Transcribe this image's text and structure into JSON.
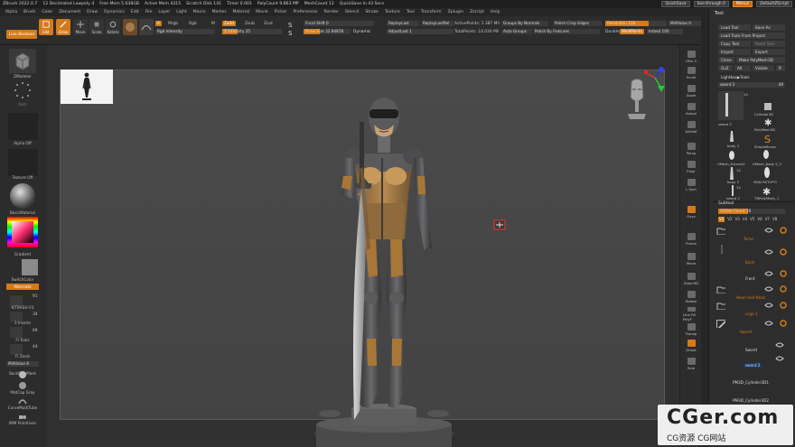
{
  "titlebar": {
    "app": "ZBrush 2022.0.7",
    "items": [
      "12 Decimated Lowpoly 4",
      "Free Mem 5.638GB",
      "Active Mem 4315",
      "Scratch Disk 141",
      "Timer 0.001",
      "PolyCount 9.863 MP",
      "MeshCount 12",
      "QuickSave In 43 Secs"
    ],
    "quicksave": "QuickSave",
    "see_through": "See-through  0",
    "menus": "Menus",
    "default_script": "DefaultZScript"
  },
  "menubar": [
    "Alpha",
    "Brush",
    "Color",
    "Document",
    "Draw",
    "Dynamics",
    "Edit",
    "File",
    "Layer",
    "Light",
    "Macro",
    "Marker",
    "Material",
    "Movie",
    "Picker",
    "Preferences",
    "Render",
    "Stencil",
    "Stroke",
    "Texture",
    "Tool",
    "Transform",
    "Zplugin",
    "Zscript",
    "Help"
  ],
  "topshelf": {
    "lightbox": "Live Boolean",
    "buttons": [
      "Edit",
      "Draw",
      "Move",
      "Scale",
      "Rotate"
    ],
    "a_btn": "A",
    "mrgb": "Mrgb",
    "rgb": "Rgb",
    "m": "M",
    "zadd": "Zadd",
    "zsub": "Zsub",
    "zcut": "Zcut",
    "rgb_intensity": "Rgb Intensity",
    "z_intensity": "Z Intensity 25",
    "focal_shift": "Focal Shift 0",
    "draw_size": "Draw Size 22.84878",
    "dynamic": "Dynamic",
    "replay_last": "ReplayLast",
    "replay_last_rel": "ReplayLastRel",
    "adjust_last": "AdjustLast 1",
    "active_points": "ActivePoints: 1.387 Mil",
    "total_points": "TotalPoints: 14.026 Mil",
    "groups_by_normals": "Groups By Normals",
    "auto_groups": "Auto Groups",
    "polish_crisp": "Polish Crisp Edges",
    "polish_features": "Polish By Features",
    "resolution": "Resolution 128",
    "double": "Double",
    "weld_points": "WeldPoints",
    "imbed": "Imbed 100",
    "mid_value": "MidValue 0"
  },
  "leftshelf": {
    "zmodeler": "ZModeler",
    "dots": "Dots",
    "alpha_off": "Alpha Off",
    "texture_off": "Texture Off",
    "basic_material": "BasicMaterial",
    "gradient": "Gradient",
    "switch_color": "SwitchColor",
    "alternate": "Alternate",
    "kitbash": "KITBASH V3",
    "kitbash_n": "91",
    "inserts": "3 Inserts",
    "inserts_n": "34",
    "fi_tools": "FI Tools",
    "fi_tools_n": "69",
    "fi_zools": "FI Zools",
    "fi_zools_n": "44",
    "mid_value": "MidValue 8",
    "backface_mask": "BackfaceMask",
    "matcap_gray": "MatCap Gray",
    "curve_multi": "CurveMultiTube",
    "imm_primitives": "IMM Primitives"
  },
  "rightshelf": [
    "SPix 3",
    "Scroll",
    "Zoom",
    "Actual",
    "AAHalf",
    "Persp",
    "Floor",
    "L.Sym",
    "Gxyz",
    "Frame",
    "Move",
    "Zoom3D",
    "Rotate",
    "Line Fill PolyF",
    "Transp",
    "Ghost",
    "Solo"
  ],
  "tool": {
    "title": "Tool",
    "buttons": [
      "Load Tool",
      "Save As",
      "Load Tools From Project",
      "Copy Tool",
      "Paste Tool",
      "Import",
      "Export",
      "Clone",
      "Make PolyMesh3D",
      "GoZ",
      "All",
      "Visible",
      "R"
    ],
    "lightbox_tools": "Lightbox▶Tools",
    "current_tool": "sword 2",
    "current_n": "49",
    "thumbs": [
      {
        "label": "sword 2",
        "n": "14"
      },
      {
        "label": "Cylinder3D"
      },
      {
        "label": "PolyMesh3D"
      },
      {
        "label": "body 3",
        "n": ""
      },
      {
        "label": "SimpleBrush"
      },
      {
        "label": "UMesh_Extract2"
      },
      {
        "label": "UMesh_body 5_2"
      },
      {
        "label": "body 5",
        "n": "14"
      },
      {
        "label": "SKIN RETOPO"
      },
      {
        "label": "sword 2",
        "n": "14"
      },
      {
        "label": "TNPolyMesh_1"
      }
    ],
    "subtool": "Subtool",
    "visible_count": "Visible Count 18",
    "v_tabs": [
      "V1",
      "V2",
      "V3",
      "V4",
      "V5",
      "V6",
      "V7",
      "V8"
    ],
    "subtools": [
      {
        "name": "Torso"
      },
      {
        "name": "Back"
      },
      {
        "name": "Front",
        "white": true
      },
      {
        "name": "Head and Neck"
      },
      {
        "name": "Legs 2"
      },
      {
        "name": "Sword"
      },
      {
        "name": "Sword",
        "white": true
      },
      {
        "name": "sword 2",
        "white": true
      },
      {
        "name": "PM3D_Cylinder3D1",
        "white": true
      },
      {
        "name": "PM3D_Cylinder3D2",
        "white": true
      }
    ]
  },
  "watermark": {
    "big": "CGer.com",
    "small": "CG资源  CG网站"
  }
}
